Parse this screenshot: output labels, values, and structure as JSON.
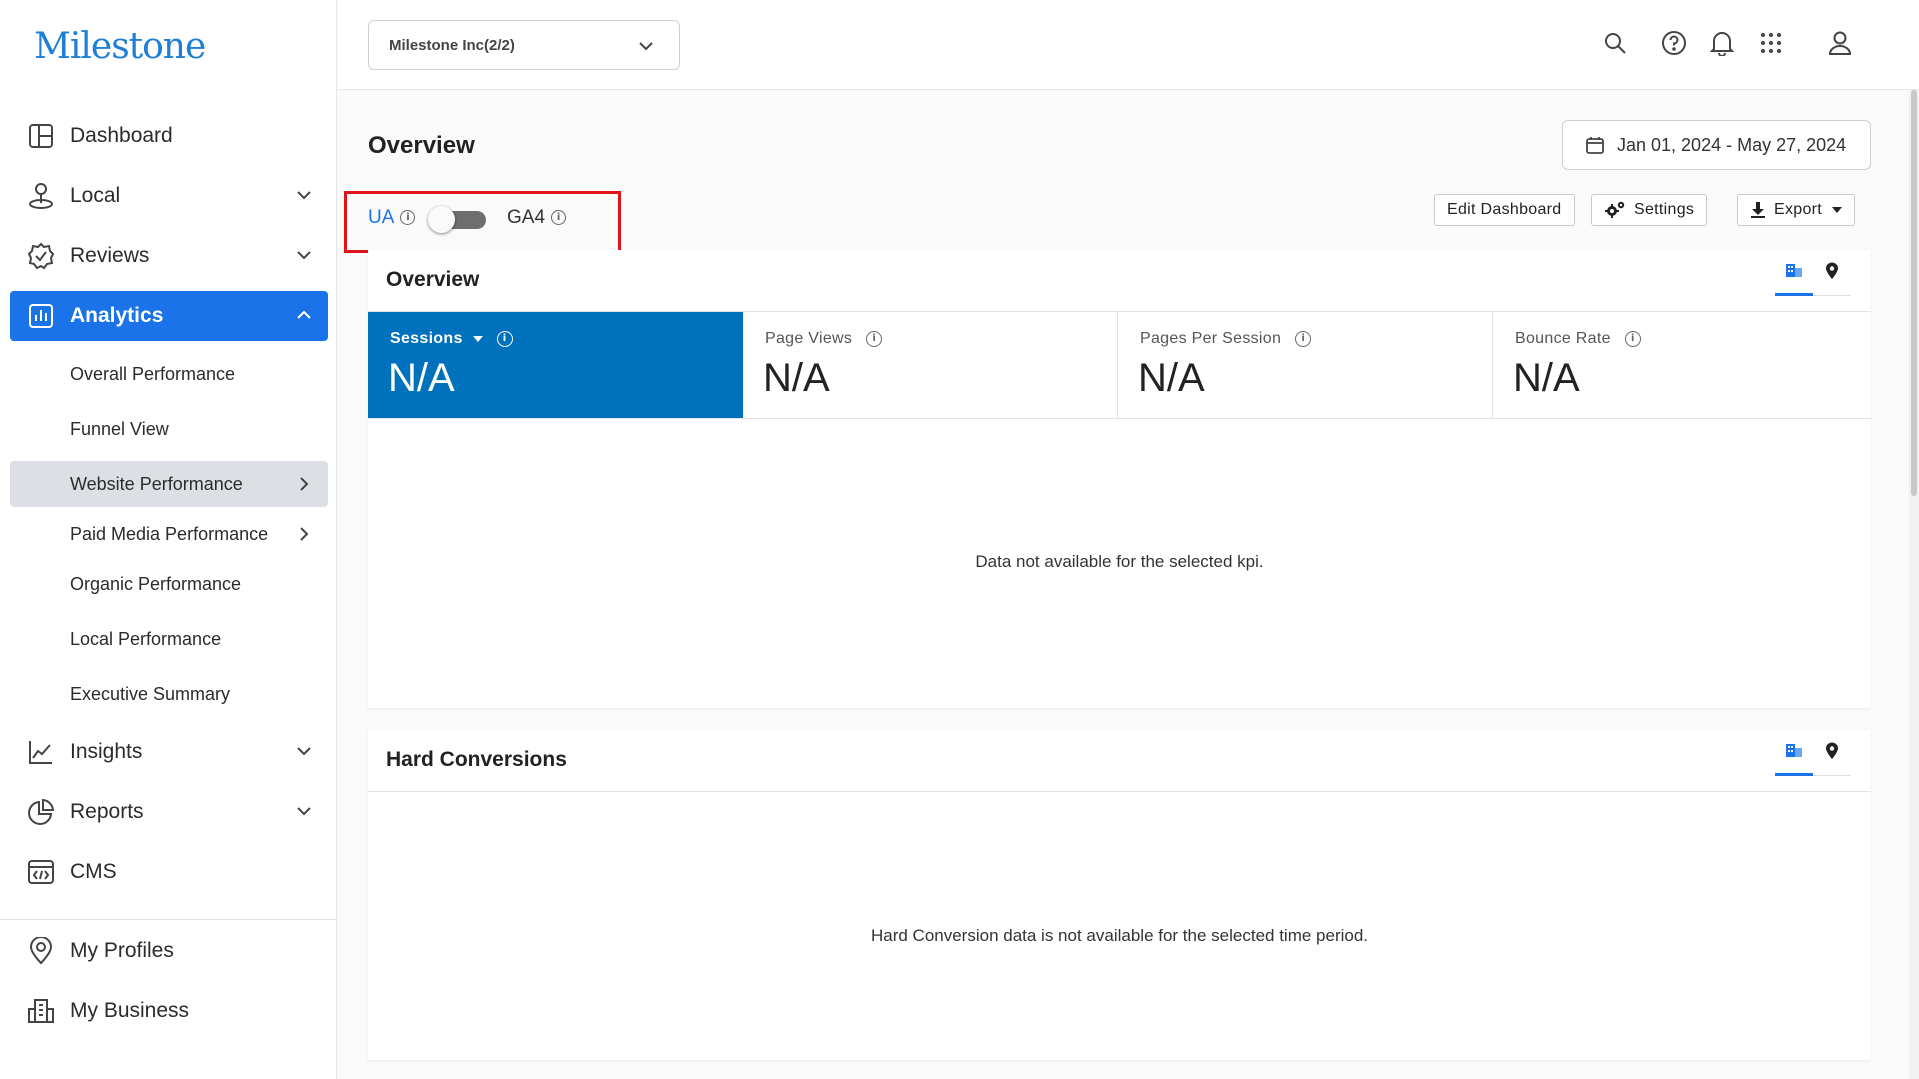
{
  "brand": {
    "logo_text": "Milestone",
    "accent": "#1a73e8",
    "highlight": "#e0131a",
    "kpi_active_bg": "#0071bc"
  },
  "sidebar": {
    "items": [
      {
        "label": "Dashboard",
        "icon": "dashboard-icon"
      },
      {
        "label": "Local",
        "icon": "local-pin-icon"
      },
      {
        "label": "Reviews",
        "icon": "reviews-check-icon"
      },
      {
        "label": "Analytics",
        "icon": "analytics-chart-icon"
      },
      {
        "label": "Insights",
        "icon": "insights-line-icon"
      },
      {
        "label": "Reports",
        "icon": "reports-pie-icon"
      },
      {
        "label": "CMS",
        "icon": "cms-code-icon"
      },
      {
        "label": "My Profiles",
        "icon": "profile-location-icon"
      },
      {
        "label": "My Business",
        "icon": "business-building-icon"
      }
    ],
    "analytics_sub": [
      {
        "label": "Overall Performance"
      },
      {
        "label": "Funnel View"
      },
      {
        "label": "Website Performance"
      },
      {
        "label": "Paid Media Performance"
      },
      {
        "label": "Organic Performance"
      },
      {
        "label": "Local Performance"
      },
      {
        "label": "Executive Summary"
      }
    ]
  },
  "topbar": {
    "account_select": "Milestone Inc(2/2)",
    "icons": [
      "search-icon",
      "help-icon",
      "bell-icon",
      "apps-grid-icon",
      "user-icon"
    ]
  },
  "main": {
    "title": "Overview",
    "date_range": "Jan 01, 2024 - May 27, 2024",
    "toggle": {
      "left": "UA",
      "right": "GA4",
      "on_right": false
    },
    "toolbar": {
      "edit": "Edit Dashboard",
      "settings": "Settings",
      "export": "Export"
    },
    "overview_card": {
      "title": "Overview",
      "kpis": [
        {
          "label": "Sessions",
          "value": "N/A"
        },
        {
          "label": "Page Views",
          "value": "N/A"
        },
        {
          "label": "Pages Per Session",
          "value": "N/A"
        },
        {
          "label": "Bounce Rate",
          "value": "N/A"
        }
      ],
      "empty_message": "Data not available for the selected kpi."
    },
    "conversions_card": {
      "title": "Hard Conversions",
      "empty_message": "Hard Conversion data is not available for the selected time period."
    }
  }
}
